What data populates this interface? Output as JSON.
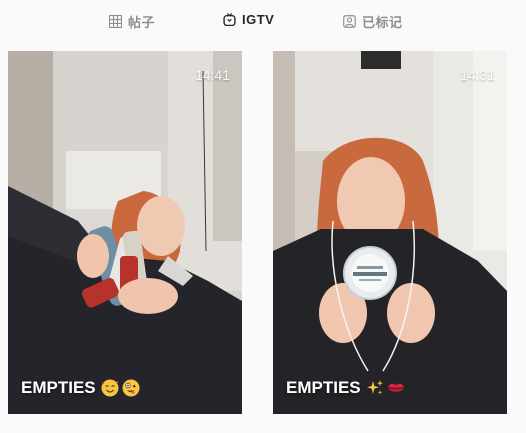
{
  "tabs": [
    {
      "label": "帖子",
      "icon": "grid-icon",
      "active": false
    },
    {
      "label": "IGTV",
      "icon": "igtv-icon",
      "active": true
    },
    {
      "label": "已标记",
      "icon": "tagged-icon",
      "active": false
    }
  ],
  "videos": [
    {
      "duration": "14:41",
      "title": "EMPTIES",
      "emojis": [
        "smiling-face-with-hearts-emoji",
        "zany-face-emoji"
      ]
    },
    {
      "duration": "14:31",
      "title": "EMPTIES",
      "emojis": [
        "sparkles-emoji",
        "kiss-mark-emoji"
      ]
    }
  ],
  "colors": {
    "active_tab": "#262626",
    "inactive_tab": "#8e8e8e",
    "background": "#fafafa"
  }
}
